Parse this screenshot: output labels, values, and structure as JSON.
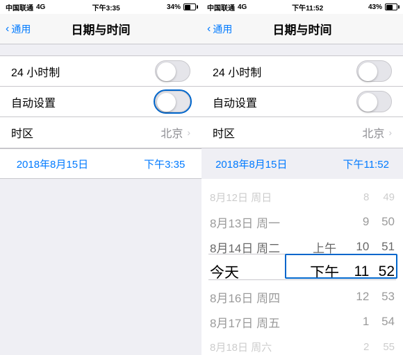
{
  "leftScreen": {
    "statusBar": {
      "carrier": "中国联通",
      "signal": "4G",
      "time": "下午3:35",
      "battery": "34%"
    },
    "navBack": "通用",
    "navTitle": "日期与时间",
    "rows": [
      {
        "label": "24 小时制",
        "type": "toggle",
        "value": false
      },
      {
        "label": "自动设置",
        "type": "toggle",
        "value": false,
        "highlighted": true
      },
      {
        "label": "时区",
        "type": "nav",
        "value": "北京"
      }
    ],
    "dateDisplay": "2018年8月15日",
    "timeDisplay": "下午3:35"
  },
  "rightScreen": {
    "statusBar": {
      "carrier": "中国联通",
      "signal": "4G",
      "time": "下午11:52",
      "battery": "43%"
    },
    "navBack": "通用",
    "navTitle": "日期与时间",
    "rows": [
      {
        "label": "24 小时制",
        "type": "toggle",
        "value": false
      },
      {
        "label": "自动设置",
        "type": "toggle",
        "value": false
      },
      {
        "label": "时区",
        "type": "nav",
        "value": "北京"
      }
    ],
    "dateDisplay": "2018年8月15日",
    "timeDisplay": "下午11:52",
    "picker": {
      "rows": [
        {
          "date": "8月12日 周日",
          "ampm": "",
          "hour": "8",
          "min": "49",
          "dimLevel": 2
        },
        {
          "date": "8月13日 周一",
          "ampm": "",
          "hour": "9",
          "min": "50",
          "dimLevel": 1
        },
        {
          "date": "8月14日 周二",
          "ampm": "上午",
          "hour": "10",
          "min": "51",
          "dimLevel": "faded"
        },
        {
          "date": "今天",
          "ampm": "下午",
          "hour": "11",
          "min": "52",
          "dimLevel": 0
        },
        {
          "date": "8月16日 周四",
          "ampm": "",
          "hour": "12",
          "min": "53",
          "dimLevel": 1
        },
        {
          "date": "8月17日 周五",
          "ampm": "",
          "hour": "1",
          "min": "54",
          "dimLevel": 1
        },
        {
          "date": "8月18日 周六",
          "ampm": "",
          "hour": "2",
          "min": "55",
          "dimLevel": 2
        }
      ]
    }
  }
}
